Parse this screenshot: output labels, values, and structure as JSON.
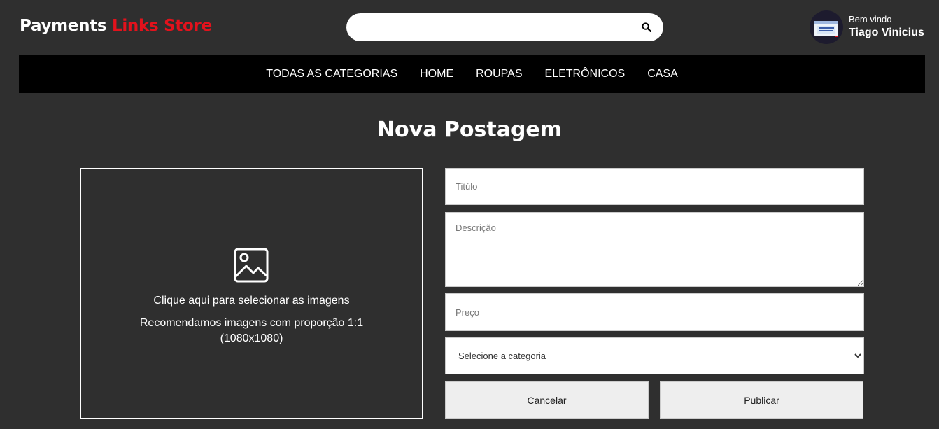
{
  "header": {
    "logo_part1": "Payments ",
    "logo_part2": "Links Store",
    "search_placeholder": "",
    "search_icon": "magnifier-icon",
    "welcome": "Bem vindo",
    "user_name": "Tiago Vinicius"
  },
  "nav": {
    "items": [
      {
        "label": "TODAS AS CATEGORIAS"
      },
      {
        "label": "HOME"
      },
      {
        "label": "ROUPAS"
      },
      {
        "label": "ELETRÔNICOS"
      },
      {
        "label": "CASA"
      }
    ]
  },
  "page": {
    "title": "Nova Postagem"
  },
  "upload": {
    "icon": "image-icon",
    "line1": "Clique aqui para selecionar as imagens",
    "line2": "Recomendamos imagens com proporção 1:1 (1080x1080)"
  },
  "form": {
    "title_placeholder": "Titúlo",
    "description_placeholder": "Descrição",
    "price_placeholder": "Preço",
    "category_selected": "Selecione a categoria",
    "cancel_label": "Cancelar",
    "publish_label": "Publicar"
  },
  "colors": {
    "background": "#2f2f2f",
    "accent": "#e3121c",
    "nav_background": "#000000",
    "button_background": "#eeeeee"
  }
}
